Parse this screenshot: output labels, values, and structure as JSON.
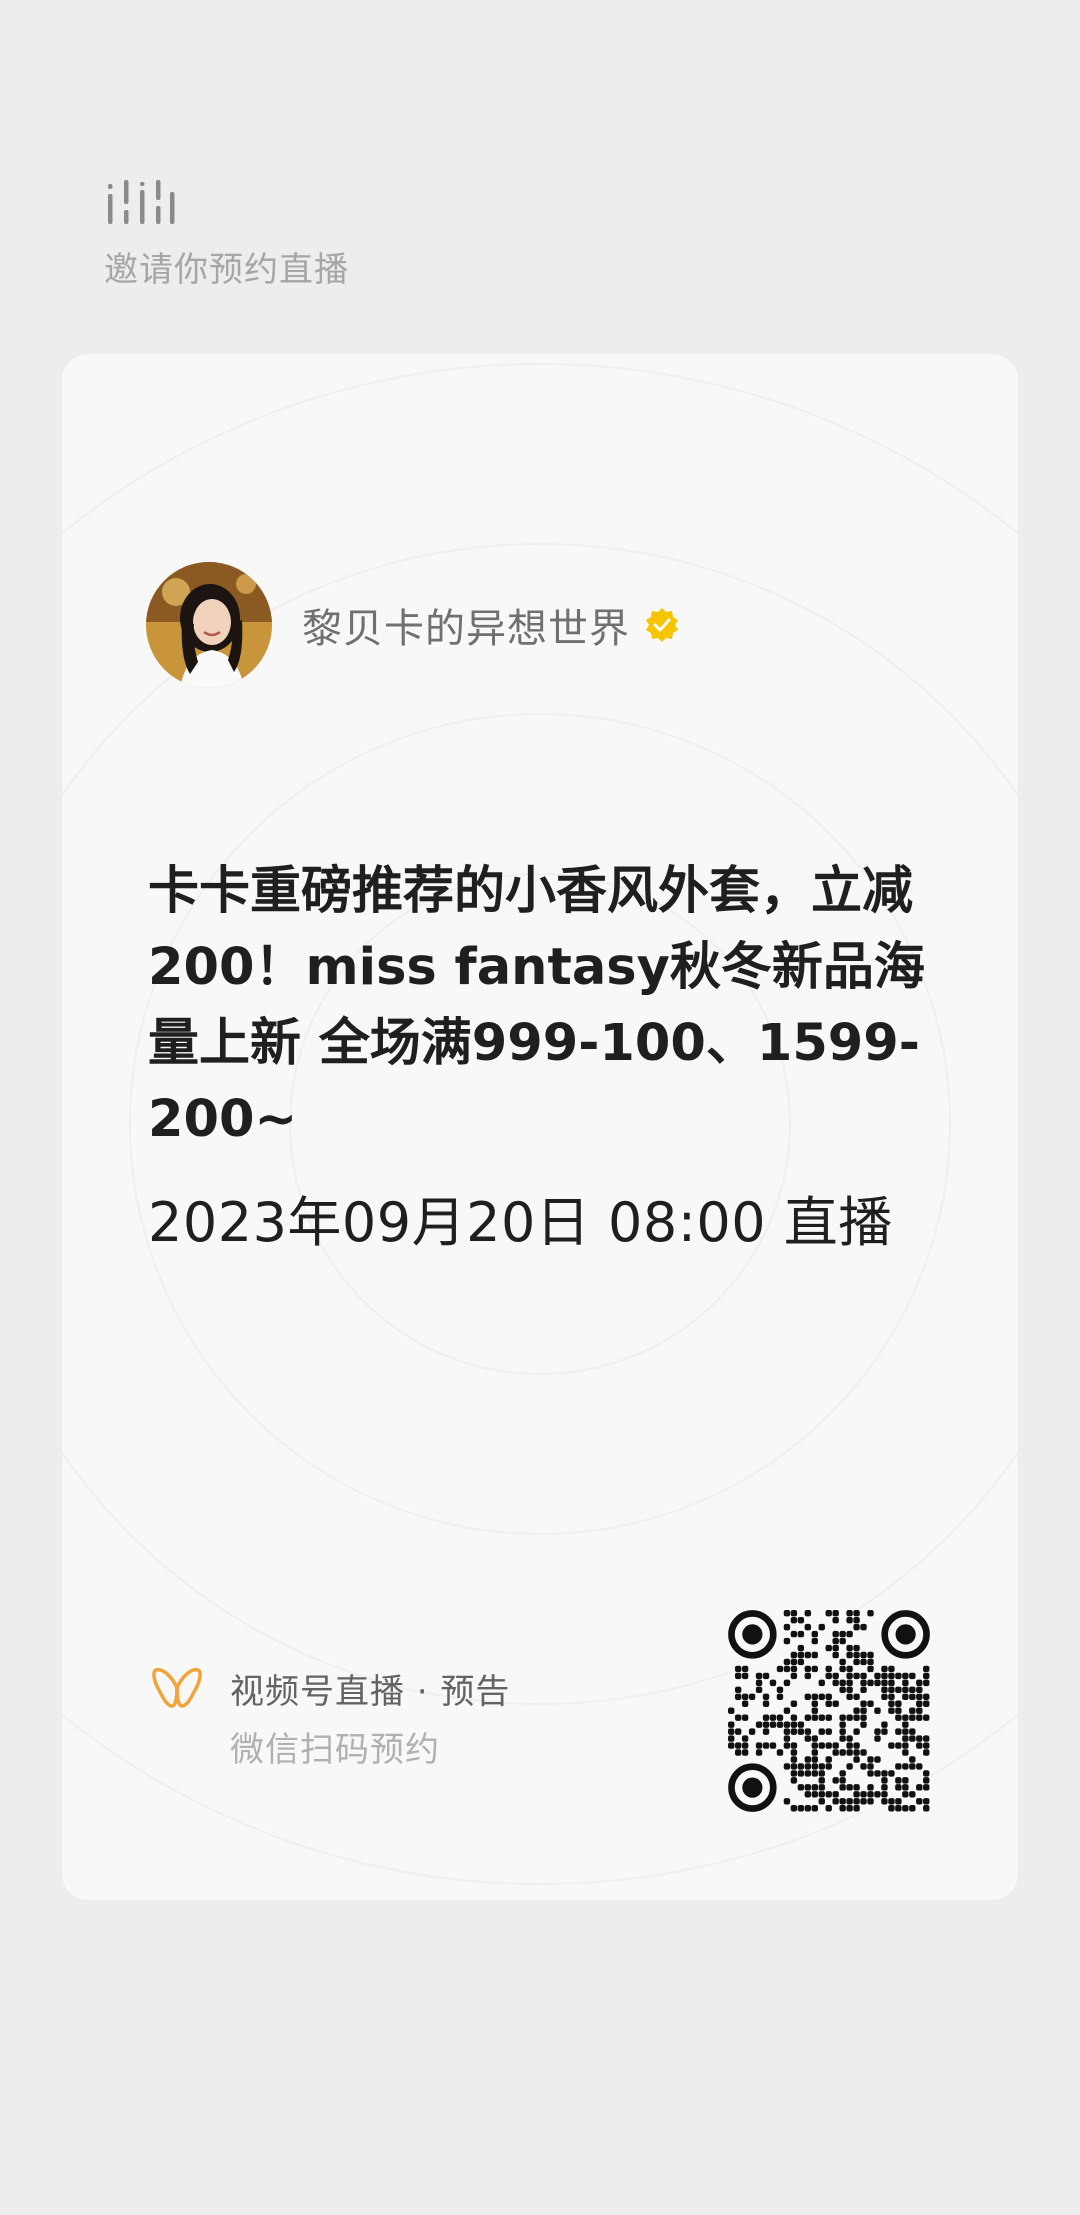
{
  "header": {
    "logo_icon": "wechat-channels-live-logo-icon",
    "subtitle": "邀请你预约直播"
  },
  "host": {
    "name": "黎贝卡的异想世界",
    "verified_icon": "verified-badge-icon",
    "verified_color": "#f7c500"
  },
  "live": {
    "title": "卡卡重磅推荐的小香风外套，立减200！miss fantasy秋冬新品海量上新 全场满999-100、1599-200~",
    "time": "2023年09月20日 08:00 直播"
  },
  "footer": {
    "brand_icon": "wechat-channels-butterfly-icon",
    "brand_color": "#f2a33a",
    "title": "视频号直播 · 预告",
    "subtitle": "微信扫码预约",
    "qr_icon": "qr-code-icon"
  }
}
